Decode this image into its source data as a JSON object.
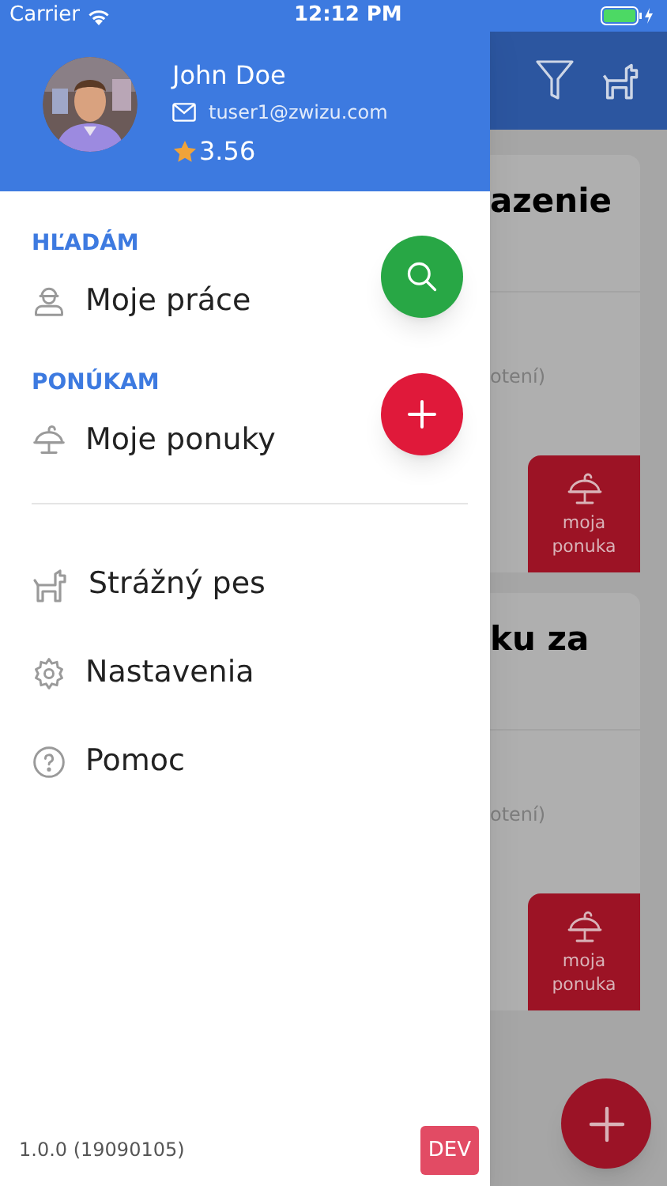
{
  "status_bar": {
    "carrier": "Carrier",
    "time": "12:12 PM"
  },
  "profile": {
    "name": "John Doe",
    "email": "tuser1@zwizu.com",
    "rating": "3.56"
  },
  "sections": [
    {
      "heading": "HĽADÁM",
      "item": "Moje práce",
      "kind": "worker",
      "button": {
        "kind": "search"
      }
    },
    {
      "heading": "PONÚKAM",
      "item": "Moje ponuky",
      "kind": "offer",
      "button": {
        "kind": "add"
      }
    }
  ],
  "menu": [
    {
      "label": "Strážný pes",
      "kind": "dog"
    },
    {
      "label": "Nastavenia",
      "kind": "gear"
    },
    {
      "label": "Pomoc",
      "kind": "help"
    }
  ],
  "version": "1.0.0 (19090105)",
  "env_badge": "DEV",
  "background": {
    "cards": [
      {
        "title": "azenie",
        "note": "otení)",
        "button": "moja ponuka"
      },
      {
        "title": "ku za",
        "note": "otení)",
        "button": "moja ponuka"
      }
    ]
  }
}
